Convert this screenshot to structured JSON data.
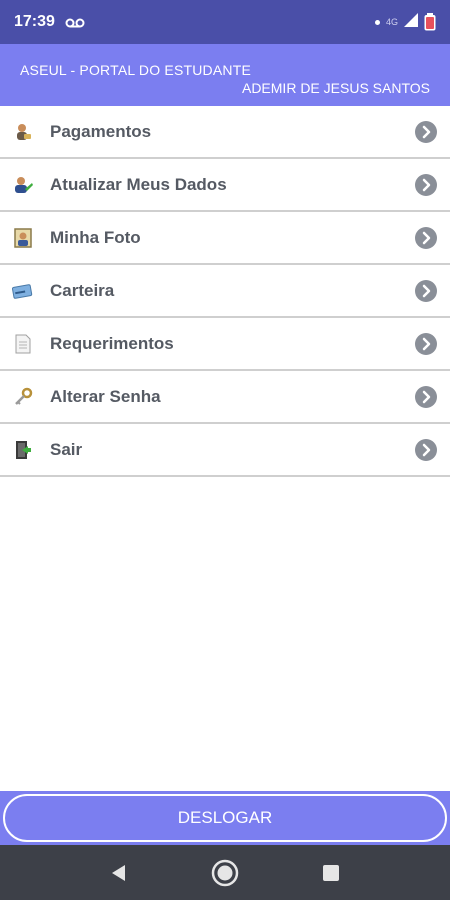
{
  "status_bar": {
    "time": "17:39",
    "network": "4G",
    "icons": [
      "voicemail-icon",
      "dot-icon",
      "signal-icon",
      "battery-icon"
    ]
  },
  "header": {
    "title": "ASEUL - PORTAL DO ESTUDANTE",
    "user": "ADEMIR DE JESUS SANTOS"
  },
  "menu": {
    "items": [
      {
        "label": "Pagamentos",
        "icon": "payment-icon"
      },
      {
        "label": "Atualizar Meus Dados",
        "icon": "user-edit-icon"
      },
      {
        "label": "Minha Foto",
        "icon": "photo-icon"
      },
      {
        "label": "Carteira",
        "icon": "card-icon"
      },
      {
        "label": "Requerimentos",
        "icon": "document-icon"
      },
      {
        "label": "Alterar Senha",
        "icon": "key-icon"
      },
      {
        "label": "Sair",
        "icon": "exit-icon"
      }
    ]
  },
  "logout": {
    "label": "DESLOGAR"
  },
  "colors": {
    "status_bar": "#4a4fa8",
    "header": "#7b7ef0",
    "menu_text": "#555a63",
    "chevron": "#8a8f98",
    "nav_bar": "#3d4048"
  }
}
